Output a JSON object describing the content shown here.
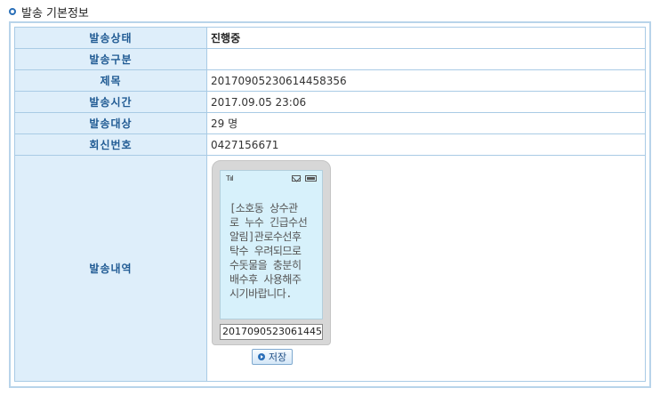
{
  "section": {
    "title": "발송 기본정보"
  },
  "rows": [
    {
      "label": "발송상태",
      "value": "진행중"
    },
    {
      "label": "발송구분",
      "value": ""
    },
    {
      "label": "제목",
      "value": "20170905230614458356"
    },
    {
      "label": "발송시간",
      "value": "2017.09.05 23:06"
    },
    {
      "label": "발송대상",
      "value": "29 명"
    },
    {
      "label": "회신번호",
      "value": "0427156671"
    }
  ],
  "content": {
    "label": "발송내역",
    "message": "[소호동 상수관\n로 누수 긴급수선\n알림]관로수선후\n탁수 우려되므로\n수돗물을 충분히\n배수후 사용해주\n시기바랍니다.",
    "message_id": "20170905230614458356",
    "status_signal": "Tııl",
    "save_label": "저장"
  },
  "icons": {
    "mail": "mail-icon",
    "battery": "battery-icon",
    "signal": "signal-icon"
  },
  "colors": {
    "label_bg": "#deeefa",
    "label_text": "#1f5a93",
    "border": "#a9cbe5",
    "screen": "#d7f1fb"
  }
}
